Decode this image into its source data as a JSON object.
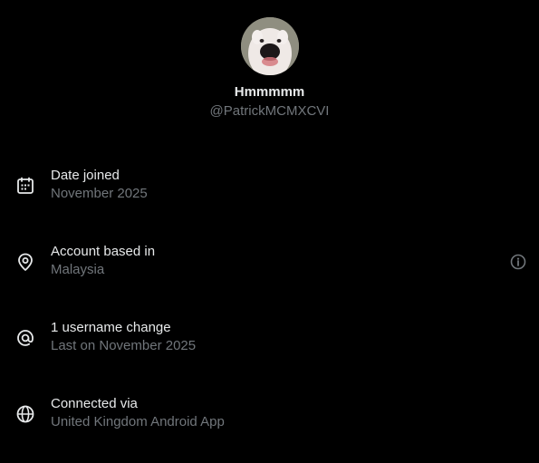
{
  "profile": {
    "display_name": "Hmmmmm",
    "handle": "@PatrickMCMXCVI"
  },
  "rows": [
    {
      "icon": "calendar-icon",
      "title": "Date joined",
      "subtitle": "November 2025"
    },
    {
      "icon": "location-pin-icon",
      "title": "Account based in",
      "subtitle": "Malaysia",
      "action_icon": "info-icon"
    },
    {
      "icon": "at-sign-icon",
      "title": "1 username change",
      "subtitle": "Last on November 2025"
    },
    {
      "icon": "globe-icon",
      "title": "Connected via",
      "subtitle": "United Kingdom Android App"
    }
  ],
  "colors": {
    "background": "#000000",
    "primary_text": "#e7e9ea",
    "secondary_text": "#71767b"
  }
}
